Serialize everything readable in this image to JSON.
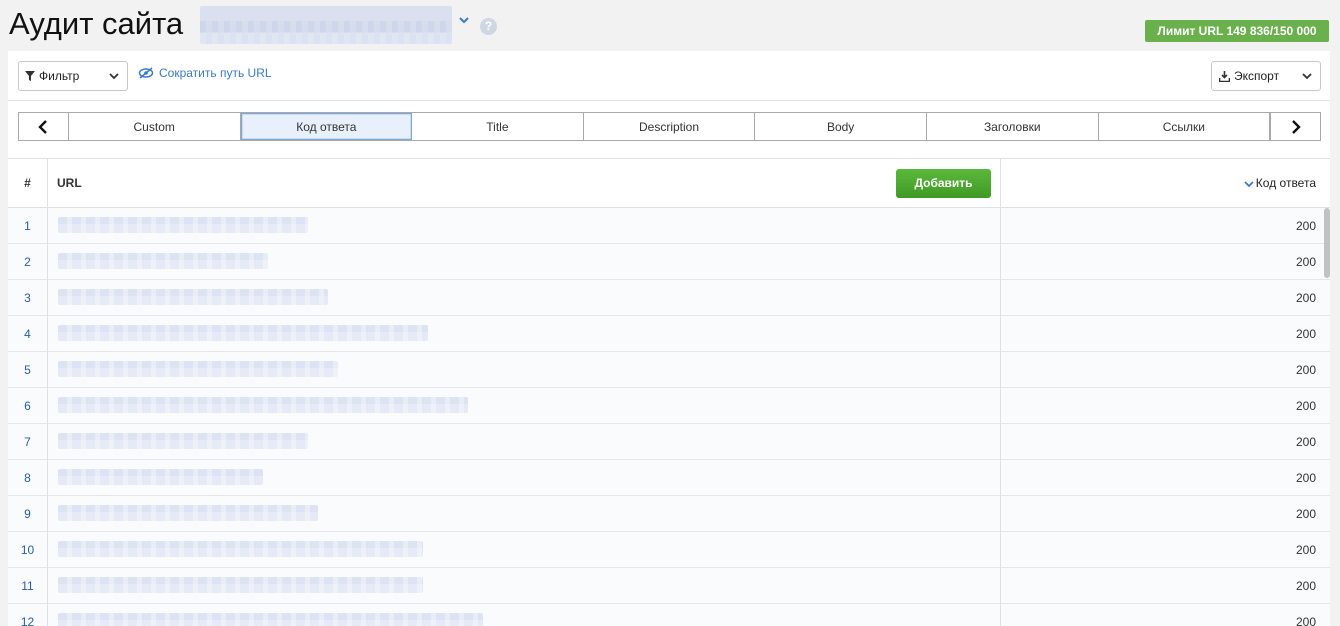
{
  "header": {
    "title": "Аудит сайта",
    "limit_badge": "Лимит URL 149 836/150 000",
    "colors": {
      "limit_bg": "#6ab04c"
    }
  },
  "toolbar": {
    "filter_label": "Фильтр",
    "shorten_label": "Сократить путь URL",
    "export_label": "Экспорт"
  },
  "tabs": [
    {
      "label": "Custom",
      "active": false
    },
    {
      "label": "Код ответа",
      "active": true
    },
    {
      "label": "Title",
      "active": false
    },
    {
      "label": "Description",
      "active": false
    },
    {
      "label": "Body",
      "active": false
    },
    {
      "label": "Заголовки",
      "active": false
    },
    {
      "label": "Ссылки",
      "active": false
    }
  ],
  "table": {
    "columns": {
      "num": "#",
      "url": "URL",
      "code": "Код ответа"
    },
    "add_label": "Добавить",
    "rows": [
      {
        "num": "1",
        "code": "200"
      },
      {
        "num": "2",
        "code": "200"
      },
      {
        "num": "3",
        "code": "200"
      },
      {
        "num": "4",
        "code": "200"
      },
      {
        "num": "5",
        "code": "200"
      },
      {
        "num": "6",
        "code": "200"
      },
      {
        "num": "7",
        "code": "200"
      },
      {
        "num": "8",
        "code": "200"
      },
      {
        "num": "9",
        "code": "200"
      },
      {
        "num": "10",
        "code": "200"
      },
      {
        "num": "11",
        "code": "200"
      },
      {
        "num": "12",
        "code": "200"
      }
    ]
  },
  "icons": {
    "filter": "filter-icon",
    "shorten": "eye-slash-icon",
    "export": "download-icon",
    "sort": "chevron-down-icon",
    "help": "help-icon"
  }
}
